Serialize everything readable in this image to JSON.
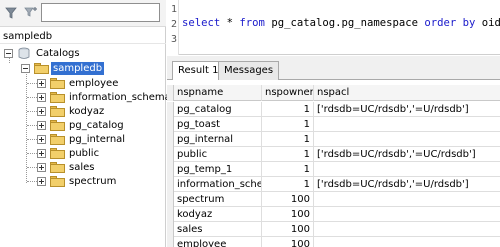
{
  "navigator": {
    "filter_value": "",
    "database_label": "sampledb",
    "root_label": "Catalogs",
    "selected_label": "sampledb",
    "schemas": [
      "employee",
      "information_schema",
      "kodyaz",
      "pg_catalog",
      "pg_internal",
      "public",
      "sales",
      "spectrum"
    ]
  },
  "editor": {
    "line_numbers": [
      "1",
      "2",
      "3"
    ],
    "sql": {
      "kw_select": "select",
      "star": " * ",
      "kw_from": "from",
      "target": " pg_catalog.pg_namespace ",
      "kw_order": "order by",
      "rest": " oid;"
    }
  },
  "result_tabs": [
    "Result 1",
    "Messages"
  ],
  "grid": {
    "columns": [
      "nspname",
      "nspowner",
      "nspacl"
    ],
    "rows": [
      [
        "pg_catalog",
        "1",
        "['rdsdb=UC/rdsdb','=U/rdsdb']"
      ],
      [
        "pg_toast",
        "1",
        ""
      ],
      [
        "pg_internal",
        "1",
        ""
      ],
      [
        "public",
        "1",
        "['rdsdb=UC/rdsdb','=UC/rdsdb']"
      ],
      [
        "pg_temp_1",
        "1",
        ""
      ],
      [
        "information_schema",
        "1",
        "['rdsdb=UC/rdsdb','=U/rdsdb']"
      ],
      [
        "spectrum",
        "100",
        ""
      ],
      [
        "kodyaz",
        "100",
        ""
      ],
      [
        "sales",
        "100",
        ""
      ],
      [
        "employee",
        "100",
        ""
      ]
    ]
  }
}
